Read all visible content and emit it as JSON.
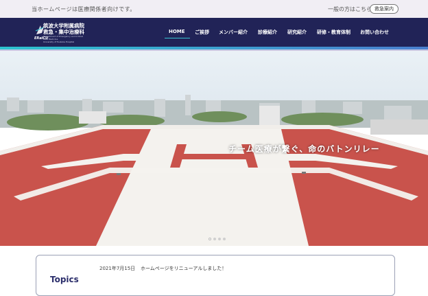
{
  "topbar": {
    "notice": "当ホームページは医療関係者向けです。",
    "general": "一般の方はこちら",
    "emergency_button": "救急案内"
  },
  "logo": {
    "brand": "ERaICU",
    "name_line1": "筑波大学附属病院",
    "name_line2": "救急・集中治療科",
    "sub_line1": "Department of Emergency and Critical Care Medicine",
    "sub_line2": "University of Tsukuba Hospital"
  },
  "nav": {
    "items": [
      {
        "label": "HOME",
        "active": true
      },
      {
        "label": "ご挨拶",
        "active": false
      },
      {
        "label": "メンバー紹介",
        "active": false
      },
      {
        "label": "診療紹介",
        "active": false
      },
      {
        "label": "研究紹介",
        "active": false
      },
      {
        "label": "研修・教育体制",
        "active": false
      },
      {
        "label": "お問い合わせ",
        "active": false
      }
    ]
  },
  "hero": {
    "tagline": "チーム医療が繋ぐ、命のバトンリレー",
    "slide_count": 4,
    "active_slide": 1
  },
  "topics": {
    "heading": "Topics",
    "items": [
      {
        "date": "2021年7月15日",
        "text": "ホームページをリニューアルしました！"
      }
    ]
  },
  "colors": {
    "navy": "#212357",
    "accent": "#2dc3cf",
    "topbar_bg": "#f1eef4"
  }
}
